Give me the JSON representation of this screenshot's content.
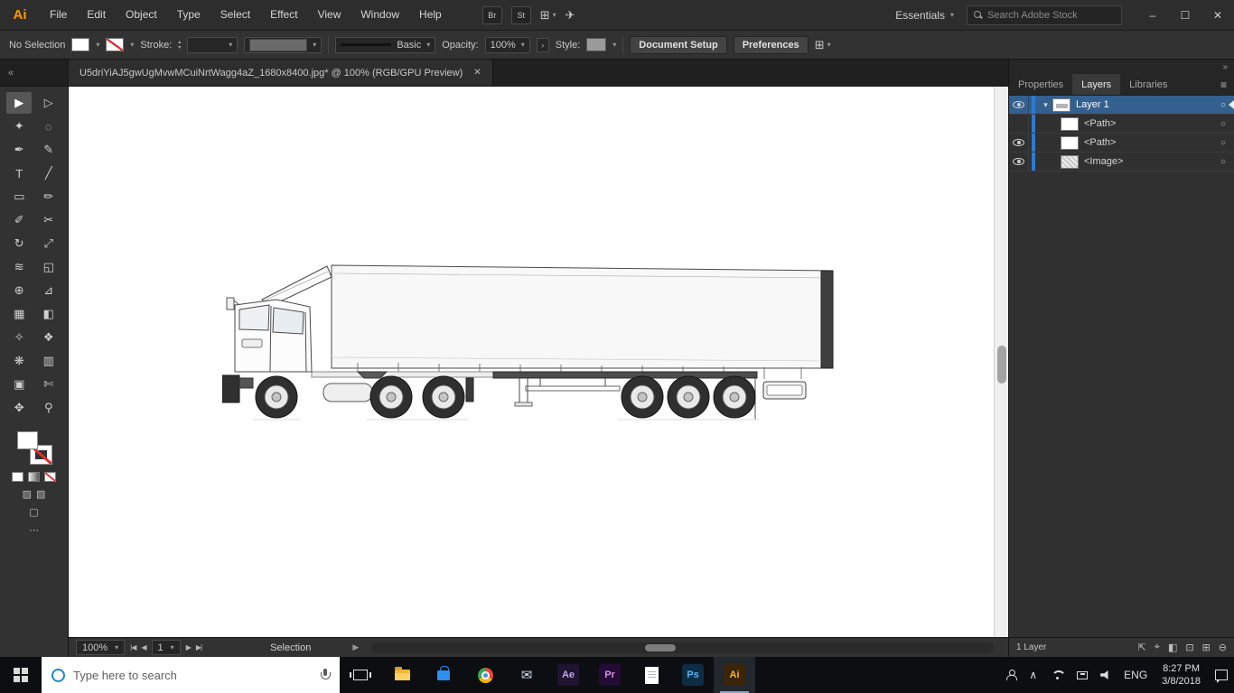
{
  "menubar": {
    "logo": "Ai",
    "items": [
      "File",
      "Edit",
      "Object",
      "Type",
      "Select",
      "Effect",
      "View",
      "Window",
      "Help"
    ],
    "bridge_label": "Br",
    "stock_label": "St",
    "workspace_label": "Essentials",
    "search_placeholder": "Search Adobe Stock"
  },
  "controlbar": {
    "selection_status": "No Selection",
    "stroke_label": "Stroke:",
    "brush_name": "Basic",
    "opacity_label": "Opacity:",
    "opacity_value": "100%",
    "style_label": "Style:",
    "document_setup_label": "Document Setup",
    "preferences_label": "Preferences"
  },
  "document_tab": {
    "title": "U5driYiAJ5gwUgMvwMCuiNrtWagg4aZ_1680x8400.jpg* @ 100% (RGB/GPU Preview)"
  },
  "tools": [
    {
      "name": "selection",
      "glyph": "▶"
    },
    {
      "name": "direct-selection",
      "glyph": "▷"
    },
    {
      "name": "magic-wand",
      "glyph": "✦"
    },
    {
      "name": "lasso",
      "glyph": "◌"
    },
    {
      "name": "pen",
      "glyph": "✒"
    },
    {
      "name": "curvature",
      "glyph": "✎"
    },
    {
      "name": "type",
      "glyph": "T"
    },
    {
      "name": "line-segment",
      "glyph": "╱"
    },
    {
      "name": "rectangle",
      "glyph": "▭"
    },
    {
      "name": "paintbrush",
      "glyph": "✏"
    },
    {
      "name": "pencil",
      "glyph": "✐"
    },
    {
      "name": "scissors",
      "glyph": "✂"
    },
    {
      "name": "rotate",
      "glyph": "↻"
    },
    {
      "name": "scale",
      "glyph": "⤢"
    },
    {
      "name": "width",
      "glyph": "≋"
    },
    {
      "name": "free-transform",
      "glyph": "◱"
    },
    {
      "name": "shape-builder",
      "glyph": "⊕"
    },
    {
      "name": "perspective-grid",
      "glyph": "⊿"
    },
    {
      "name": "mesh",
      "glyph": "▦"
    },
    {
      "name": "gradient",
      "glyph": "◧"
    },
    {
      "name": "eyedropper",
      "glyph": "✧"
    },
    {
      "name": "blend",
      "glyph": "❖"
    },
    {
      "name": "symbol-sprayer",
      "glyph": "❋"
    },
    {
      "name": "graph",
      "glyph": "▥"
    },
    {
      "name": "artboard",
      "glyph": "▣"
    },
    {
      "name": "slice",
      "glyph": "✄"
    },
    {
      "name": "hand",
      "glyph": "✥"
    },
    {
      "name": "zoom",
      "glyph": "⚲"
    }
  ],
  "layers_panel": {
    "tabs": [
      "Properties",
      "Layers",
      "Libraries"
    ],
    "rows": [
      {
        "label": "Layer 1",
        "type": "layer",
        "visible": true,
        "selected": true
      },
      {
        "label": "<Path>",
        "type": "path",
        "visible": false,
        "selected": false
      },
      {
        "label": "<Path>",
        "type": "path",
        "visible": true,
        "selected": false
      },
      {
        "label": "<Image>",
        "type": "image",
        "visible": true,
        "selected": false
      }
    ],
    "footer_count": "1 Layer"
  },
  "statusbar": {
    "zoom": "100%",
    "artboard_number": "1",
    "tool_status": "Selection"
  },
  "taskbar": {
    "search_placeholder": "Type here to search",
    "apps": [
      {
        "abbr": "Ae"
      },
      {
        "abbr": "Pr"
      },
      {
        "abbr": "Ps"
      },
      {
        "abbr": "Ai"
      }
    ],
    "language_label": "ENG",
    "time": "8:27 PM",
    "date": "3/8/2018"
  },
  "icons": {
    "double_chevron_left": "«",
    "double_chevron_right": "»",
    "chevron_down": "▾",
    "chevron_right": "›",
    "close": "✕",
    "minimize": "–",
    "maximize": "☐",
    "menu": "≡",
    "target": "○",
    "envelope": "✉",
    "share": "✈",
    "grid": "⊞",
    "nav_first": "|◀",
    "nav_prev": "◀",
    "nav_next": "▶",
    "nav_last": "▶|",
    "spin_up": "▴",
    "spin_down": "▾",
    "chevron_up": "∧",
    "screen_mode": "▢",
    "draw_mode_a": "▨",
    "draw_mode_b": "▧",
    "edit_toolbar": "⋯",
    "footer_icons": [
      {
        "name": "collect-for-export",
        "glyph": "⇱"
      },
      {
        "name": "locate-object",
        "glyph": "⌖"
      },
      {
        "name": "make-clipping-mask",
        "glyph": "◧"
      },
      {
        "name": "new-sublayer",
        "glyph": "⊡"
      },
      {
        "name": "new-layer",
        "glyph": "⊞"
      },
      {
        "name": "delete-layer",
        "glyph": "⊖"
      }
    ]
  },
  "colors": {
    "accent_orange": "#ff9a00",
    "selection_blue": "#33608e",
    "layer_color_blue": "#2d7ad1"
  }
}
